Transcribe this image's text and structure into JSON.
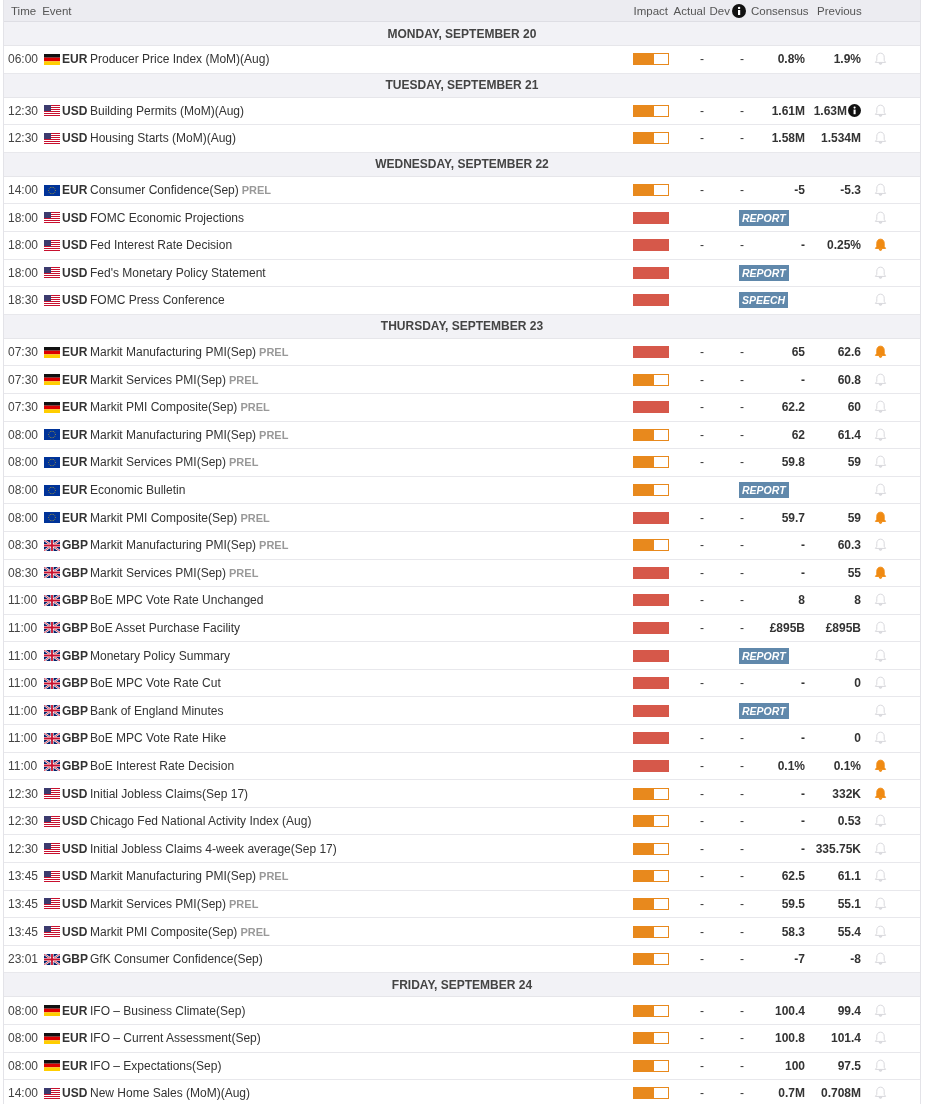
{
  "header": {
    "time": "Time",
    "event": "Event",
    "impact": "Impact",
    "actual": "Actual",
    "dev": "Dev",
    "consensus": "Consensus",
    "previous": "Previous"
  },
  "days": [
    {
      "title": "MONDAY, SEPTEMBER 20",
      "events": [
        {
          "kind": "data",
          "time": "06:00",
          "flag": {
            "kind": "de"
          },
          "currency": "EUR",
          "name": "Producer Price Index (MoM)(Aug)",
          "level": 0.6,
          "actual": "-",
          "dev": "-",
          "consensus": "0.8%",
          "previous": "1.9%",
          "revised": false,
          "alert": false
        }
      ]
    },
    {
      "title": "TUESDAY, SEPTEMBER 21",
      "events": [
        {
          "kind": "data",
          "time": "12:30",
          "flag": {
            "kind": "us"
          },
          "currency": "USD",
          "name": "Building Permits (MoM)(Aug)",
          "level": 0.6,
          "actual": "-",
          "dev": "-",
          "consensus": "1.61M",
          "previous": "1.63M",
          "revised": true,
          "alert": false
        },
        {
          "kind": "data",
          "time": "12:30",
          "flag": {
            "kind": "us"
          },
          "currency": "USD",
          "name": "Housing Starts (MoM)(Aug)",
          "level": 0.6,
          "actual": "-",
          "dev": "-",
          "consensus": "1.58M",
          "previous": "1.534M",
          "revised": false,
          "alert": false
        }
      ]
    },
    {
      "title": "WEDNESDAY, SEPTEMBER 22",
      "events": [
        {
          "kind": "data",
          "time": "14:00",
          "flag": {
            "kind": "eu"
          },
          "currency": "EUR",
          "name": "Consumer Confidence(Sep)",
          "note": "PREL",
          "level": 0.6,
          "actual": "-",
          "dev": "-",
          "consensus": "-5",
          "previous": "-5.3",
          "revised": false,
          "alert": false
        },
        {
          "kind": "release",
          "time": "18:00",
          "flag": {
            "kind": "us"
          },
          "currency": "USD",
          "name": "FOMC Economic Projections",
          "level": 1,
          "tag": "REPORT",
          "alert": false
        },
        {
          "kind": "data",
          "time": "18:00",
          "flag": {
            "kind": "us"
          },
          "currency": "USD",
          "name": "Fed Interest Rate Decision",
          "level": 1,
          "actual": "-",
          "dev": "-",
          "consensus": "-",
          "previous": "0.25%",
          "revised": false,
          "alert": true
        },
        {
          "kind": "release",
          "time": "18:00",
          "flag": {
            "kind": "us"
          },
          "currency": "USD",
          "name": "Fed's Monetary Policy Statement",
          "level": 1,
          "tag": "REPORT",
          "alert": false
        },
        {
          "kind": "release",
          "time": "18:30",
          "flag": {
            "kind": "us"
          },
          "currency": "USD",
          "name": "FOMC Press Conference",
          "level": 1,
          "tag": "SPEECH",
          "alert": false
        }
      ]
    },
    {
      "title": "THURSDAY, SEPTEMBER 23",
      "events": [
        {
          "kind": "data",
          "time": "07:30",
          "flag": {
            "kind": "de"
          },
          "currency": "EUR",
          "name": "Markit Manufacturing PMI(Sep)",
          "note": "PREL",
          "level": 1,
          "actual": "-",
          "dev": "-",
          "consensus": "65",
          "previous": "62.6",
          "revised": false,
          "alert": true
        },
        {
          "kind": "data",
          "time": "07:30",
          "flag": {
            "kind": "de"
          },
          "currency": "EUR",
          "name": "Markit Services PMI(Sep)",
          "note": "PREL",
          "level": 0.6,
          "actual": "-",
          "dev": "-",
          "consensus": "-",
          "previous": "60.8",
          "revised": false,
          "alert": false
        },
        {
          "kind": "data",
          "time": "07:30",
          "flag": {
            "kind": "de"
          },
          "currency": "EUR",
          "name": "Markit PMI Composite(Sep)",
          "note": "PREL",
          "level": 1,
          "actual": "-",
          "dev": "-",
          "consensus": "62.2",
          "previous": "60",
          "revised": false,
          "alert": false
        },
        {
          "kind": "data",
          "time": "08:00",
          "flag": {
            "kind": "eu"
          },
          "currency": "EUR",
          "name": "Markit Manufacturing PMI(Sep)",
          "note": "PREL",
          "level": 0.6,
          "actual": "-",
          "dev": "-",
          "consensus": "62",
          "previous": "61.4",
          "revised": false,
          "alert": false
        },
        {
          "kind": "data",
          "time": "08:00",
          "flag": {
            "kind": "eu"
          },
          "currency": "EUR",
          "name": "Markit Services PMI(Sep)",
          "note": "PREL",
          "level": 0.6,
          "actual": "-",
          "dev": "-",
          "consensus": "59.8",
          "previous": "59",
          "revised": false,
          "alert": false
        },
        {
          "kind": "release",
          "time": "08:00",
          "flag": {
            "kind": "eu"
          },
          "currency": "EUR",
          "name": "Economic Bulletin",
          "level": 0.6,
          "tag": "REPORT",
          "alert": false
        },
        {
          "kind": "data",
          "time": "08:00",
          "flag": {
            "kind": "eu"
          },
          "currency": "EUR",
          "name": "Markit PMI Composite(Sep)",
          "note": "PREL",
          "level": 1,
          "actual": "-",
          "dev": "-",
          "consensus": "59.7",
          "previous": "59",
          "revised": false,
          "alert": true
        },
        {
          "kind": "data",
          "time": "08:30",
          "flag": {
            "kind": "gb"
          },
          "currency": "GBP",
          "name": "Markit Manufacturing PMI(Sep)",
          "note": "PREL",
          "level": 0.6,
          "actual": "-",
          "dev": "-",
          "consensus": "-",
          "previous": "60.3",
          "revised": false,
          "alert": false
        },
        {
          "kind": "data",
          "time": "08:30",
          "flag": {
            "kind": "gb"
          },
          "currency": "GBP",
          "name": "Markit Services PMI(Sep)",
          "note": "PREL",
          "level": 1,
          "actual": "-",
          "dev": "-",
          "consensus": "-",
          "previous": "55",
          "revised": false,
          "alert": true
        },
        {
          "kind": "data",
          "time": "11:00",
          "flag": {
            "kind": "gb"
          },
          "currency": "GBP",
          "name": "BoE MPC Vote Rate Unchanged",
          "level": 1,
          "actual": "-",
          "dev": "-",
          "consensus": "8",
          "previous": "8",
          "revised": false,
          "alert": false
        },
        {
          "kind": "data",
          "time": "11:00",
          "flag": {
            "kind": "gb"
          },
          "currency": "GBP",
          "name": "BoE Asset Purchase Facility",
          "level": 1,
          "actual": "-",
          "dev": "-",
          "consensus": "£895B",
          "previous": "£895B",
          "revised": false,
          "alert": false
        },
        {
          "kind": "release",
          "time": "11:00",
          "flag": {
            "kind": "gb"
          },
          "currency": "GBP",
          "name": "Monetary Policy Summary",
          "level": 1,
          "tag": "REPORT",
          "alert": false
        },
        {
          "kind": "data",
          "time": "11:00",
          "flag": {
            "kind": "gb"
          },
          "currency": "GBP",
          "name": "BoE MPC Vote Rate Cut",
          "level": 1,
          "actual": "-",
          "dev": "-",
          "consensus": "-",
          "previous": "0",
          "revised": false,
          "alert": false
        },
        {
          "kind": "release",
          "time": "11:00",
          "flag": {
            "kind": "gb"
          },
          "currency": "GBP",
          "name": "Bank of England Minutes",
          "level": 1,
          "tag": "REPORT",
          "alert": false
        },
        {
          "kind": "data",
          "time": "11:00",
          "flag": {
            "kind": "gb"
          },
          "currency": "GBP",
          "name": "BoE MPC Vote Rate Hike",
          "level": 1,
          "actual": "-",
          "dev": "-",
          "consensus": "-",
          "previous": "0",
          "revised": false,
          "alert": false
        },
        {
          "kind": "data",
          "time": "11:00",
          "flag": {
            "kind": "gb"
          },
          "currency": "GBP",
          "name": "BoE Interest Rate Decision",
          "level": 1,
          "actual": "-",
          "dev": "-",
          "consensus": "0.1%",
          "previous": "0.1%",
          "revised": false,
          "alert": true
        },
        {
          "kind": "data",
          "time": "12:30",
          "flag": {
            "kind": "us"
          },
          "currency": "USD",
          "name": "Initial Jobless Claims(Sep 17)",
          "level": 0.6,
          "actual": "-",
          "dev": "-",
          "consensus": "-",
          "previous": "332K",
          "revised": false,
          "alert": true
        },
        {
          "kind": "data",
          "time": "12:30",
          "flag": {
            "kind": "us"
          },
          "currency": "USD",
          "name": "Chicago Fed National Activity Index (Aug)",
          "level": 0.6,
          "actual": "-",
          "dev": "-",
          "consensus": "-",
          "previous": "0.53",
          "revised": false,
          "alert": false
        },
        {
          "kind": "data",
          "time": "12:30",
          "flag": {
            "kind": "us"
          },
          "currency": "USD",
          "name": "Initial Jobless Claims 4-week average(Sep 17)",
          "level": 0.6,
          "actual": "-",
          "dev": "-",
          "consensus": "-",
          "previous": "335.75K",
          "revised": false,
          "alert": false
        },
        {
          "kind": "data",
          "time": "13:45",
          "flag": {
            "kind": "us"
          },
          "currency": "USD",
          "name": "Markit Manufacturing PMI(Sep)",
          "note": "PREL",
          "level": 0.6,
          "actual": "-",
          "dev": "-",
          "consensus": "62.5",
          "previous": "61.1",
          "revised": false,
          "alert": false
        },
        {
          "kind": "data",
          "time": "13:45",
          "flag": {
            "kind": "us"
          },
          "currency": "USD",
          "name": "Markit Services PMI(Sep)",
          "note": "PREL",
          "level": 0.6,
          "actual": "-",
          "dev": "-",
          "consensus": "59.5",
          "previous": "55.1",
          "revised": false,
          "alert": false
        },
        {
          "kind": "data",
          "time": "13:45",
          "flag": {
            "kind": "us"
          },
          "currency": "USD",
          "name": "Markit PMI Composite(Sep)",
          "note": "PREL",
          "level": 0.6,
          "actual": "-",
          "dev": "-",
          "consensus": "58.3",
          "previous": "55.4",
          "revised": false,
          "alert": false
        },
        {
          "kind": "data",
          "time": "23:01",
          "flag": {
            "kind": "gb"
          },
          "currency": "GBP",
          "name": "GfK Consumer Confidence(Sep)",
          "level": 0.6,
          "actual": "-",
          "dev": "-",
          "consensus": "-7",
          "previous": "-8",
          "revised": false,
          "alert": false
        }
      ]
    },
    {
      "title": "FRIDAY, SEPTEMBER 24",
      "events": [
        {
          "kind": "data",
          "time": "08:00",
          "flag": {
            "kind": "de"
          },
          "currency": "EUR",
          "name": "IFO – Business Climate(Sep)",
          "level": 0.6,
          "actual": "-",
          "dev": "-",
          "consensus": "100.4",
          "previous": "99.4",
          "revised": false,
          "alert": false
        },
        {
          "kind": "data",
          "time": "08:00",
          "flag": {
            "kind": "de"
          },
          "currency": "EUR",
          "name": "IFO – Current Assessment(Sep)",
          "level": 0.6,
          "actual": "-",
          "dev": "-",
          "consensus": "100.8",
          "previous": "101.4",
          "revised": false,
          "alert": false
        },
        {
          "kind": "data",
          "time": "08:00",
          "flag": {
            "kind": "de"
          },
          "currency": "EUR",
          "name": "IFO – Expectations(Sep)",
          "level": 0.6,
          "actual": "-",
          "dev": "-",
          "consensus": "100",
          "previous": "97.5",
          "revised": false,
          "alert": false
        },
        {
          "kind": "data",
          "time": "14:00",
          "flag": {
            "kind": "us"
          },
          "currency": "USD",
          "name": "New Home Sales (MoM)(Aug)",
          "level": 0.6,
          "actual": "-",
          "dev": "-",
          "consensus": "0.7M",
          "previous": "0.708M",
          "revised": false,
          "alert": false
        }
      ]
    }
  ]
}
